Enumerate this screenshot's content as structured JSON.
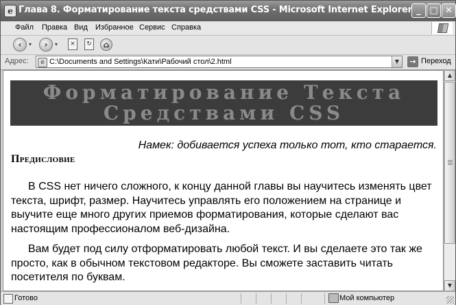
{
  "window": {
    "title": "Глава 8. Форматирование текста средствами CSS - Microsoft Internet Explorer",
    "controls": {
      "minimize": "_",
      "maximize": "□",
      "close": "✕"
    }
  },
  "menu": {
    "items": [
      {
        "label": "Файл"
      },
      {
        "label": "Правка"
      },
      {
        "label": "Вид"
      },
      {
        "label": "Избранное"
      },
      {
        "label": "Сервис"
      },
      {
        "label": "Справка"
      }
    ]
  },
  "toolbar": {
    "back_icon": "back-arrow-icon",
    "forward_icon": "forward-arrow-icon",
    "stop_icon": "stop-icon",
    "refresh_icon": "refresh-icon",
    "home_icon": "home-icon"
  },
  "address": {
    "label": "Адрес:",
    "value": "C:\\Documents and Settings\\Кати\\Рабочий стол\\2.html",
    "go_label": "Переход"
  },
  "page": {
    "banner_line1": "Форматирование Текста",
    "banner_line2": "Средствами CSS",
    "quote": "Намек: добивается успеха только тот, кто старается.",
    "heading": "Предисловие",
    "paragraph1": "В CSS нет ничего сложного, к концу данной главы вы научитесь изменять цвет текста, шрифт, размер. Научитесь управлять его положением на странице и выучите еще много других приемов форматирования, которые сделают вас настоящим профессионалом веб-дизайна.",
    "paragraph2": "Вам будет под силу отформатировать любой текст. И вы сделаете это так же просто, как в обычном текстовом редакторе. Вы сможете заставить читать посетителя по буквам."
  },
  "status": {
    "text": "Готово",
    "zone": "Мой компьютер"
  },
  "colors": {
    "banner_bg": "#3c3c3c",
    "banner_text": "#8a8a8a",
    "titlebar": "#6e6e6e"
  }
}
